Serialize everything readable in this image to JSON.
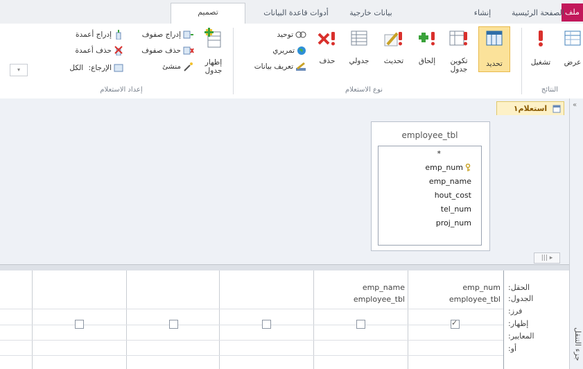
{
  "tabs": {
    "file": "ملف",
    "home": "الصفحة الرئيسية",
    "create": "إنشاء",
    "external": "بيانات خارجية",
    "dbtools": "أدوات قاعدة البيانات",
    "design": "تصميم"
  },
  "ribbon": {
    "results": {
      "view": "عرض",
      "run": "تشغيل",
      "group": "النتائج"
    },
    "query_type": {
      "select": "تحديد",
      "make_table": "تكوين",
      "make_table_2": "جدول",
      "append": "إلحاق",
      "update": "تحديث",
      "crosstab": "جدولي",
      "delete": "حذف",
      "union": "توحيد",
      "passthrough": "تمريري",
      "data_def": "تعريف بيانات",
      "group": "نوع الاستعلام"
    },
    "setup": {
      "show_table": "إظهار",
      "show_table_2": "جدول",
      "insert_rows": "إدراج صفوف",
      "delete_rows": "حذف صفوف",
      "builder": "منشئ",
      "insert_cols": "إدراج أعمدة",
      "delete_cols": "حذف أعمدة",
      "return_label": "الإرجاع:",
      "return_value": "الكل",
      "group": "إعداد الاستعلام"
    }
  },
  "document": {
    "tab_title": "استعلام١"
  },
  "table": {
    "name": "employee_tbl",
    "fields": [
      "*",
      "emp_num",
      "emp_name",
      "hout_cost",
      "tel_num",
      "proj_num"
    ]
  },
  "grid": {
    "row_labels": [
      "الحقل:",
      "الجدول:",
      "فرز:",
      "إظهار:",
      "المعايير:",
      "أو:"
    ],
    "columns": [
      {
        "field": "emp_num",
        "table": "employee_tbl",
        "show": true
      },
      {
        "field": "emp_name",
        "table": "employee_tbl",
        "show": false
      },
      {
        "field": "",
        "table": "",
        "show": false
      },
      {
        "field": "",
        "table": "",
        "show": false
      },
      {
        "field": "",
        "table": "",
        "show": false
      }
    ]
  },
  "navpane": {
    "label": "جزء التنقل"
  },
  "colors": {
    "file_tab": "#c2185b",
    "accent_select": "#f6d66e"
  }
}
